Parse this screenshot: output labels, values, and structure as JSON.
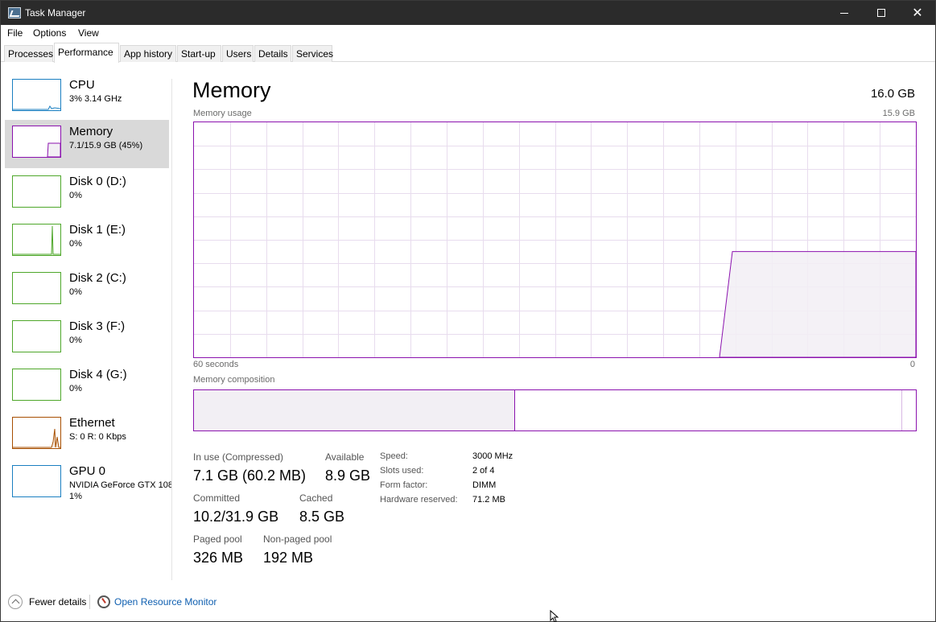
{
  "window": {
    "title": "Task Manager"
  },
  "menu": [
    "File",
    "Options",
    "View"
  ],
  "tabs": [
    "Processes",
    "Performance",
    "App history",
    "Start-up",
    "Users",
    "Details",
    "Services"
  ],
  "active_tab": "Performance",
  "sidebar": [
    {
      "name": "CPU",
      "sub": "3% 3.14 GHz",
      "color": "#1a7fc1"
    },
    {
      "name": "Memory",
      "sub": "7.1/15.9 GB (45%)",
      "color": "#8b12ae",
      "selected": true
    },
    {
      "name": "Disk 0 (D:)",
      "sub": "0%",
      "color": "#4ea72a"
    },
    {
      "name": "Disk 1 (E:)",
      "sub": "0%",
      "color": "#4ea72a"
    },
    {
      "name": "Disk 2 (C:)",
      "sub": "0%",
      "color": "#4ea72a"
    },
    {
      "name": "Disk 3 (F:)",
      "sub": "0%",
      "color": "#4ea72a"
    },
    {
      "name": "Disk 4 (G:)",
      "sub": "0%",
      "color": "#4ea72a"
    },
    {
      "name": "Ethernet",
      "sub": "S: 0 R: 0 Kbps",
      "color": "#a74f01"
    },
    {
      "name": "GPU 0",
      "sub": "NVIDIA GeForce GTX 108",
      "sub2": "1%",
      "color": "#1a7fc1"
    }
  ],
  "main": {
    "title": "Memory",
    "total": "16.0 GB",
    "usage_label": "Memory usage",
    "usage_max": "15.9 GB",
    "time_left": "60 seconds",
    "time_right": "0",
    "composition_label": "Memory composition",
    "usage_fraction": 0.45,
    "composition": {
      "in_use_fraction": 0.445,
      "standby_fraction": 0.533
    },
    "stats": {
      "in_use_label": "In use (Compressed)",
      "in_use_value": "7.1 GB (60.2 MB)",
      "available_label": "Available",
      "available_value": "8.9 GB",
      "committed_label": "Committed",
      "committed_value": "10.2/31.9 GB",
      "cached_label": "Cached",
      "cached_value": "8.5 GB",
      "paged_label": "Paged pool",
      "paged_value": "326 MB",
      "nonpaged_label": "Non-paged pool",
      "nonpaged_value": "192 MB"
    },
    "details": [
      {
        "label": "Speed:",
        "value": "3000 MHz"
      },
      {
        "label": "Slots used:",
        "value": "2 of 4"
      },
      {
        "label": "Form factor:",
        "value": "DIMM"
      },
      {
        "label": "Hardware reserved:",
        "value": "71.2 MB"
      }
    ]
  },
  "footer": {
    "fewer_details": "Fewer details",
    "open_resource_monitor": "Open Resource Monitor"
  },
  "colors": {
    "memory": "#8b12ae",
    "memory_fill": "#f2eff4",
    "grid": "#e8dcee"
  }
}
